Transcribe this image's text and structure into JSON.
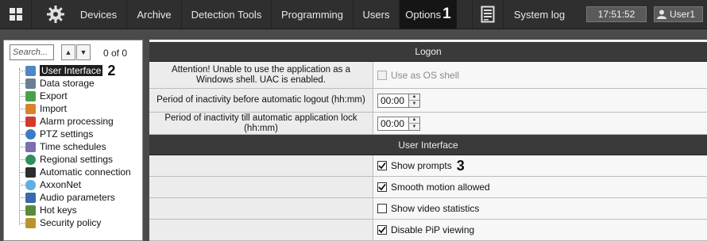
{
  "topbar": {
    "tabs": [
      "Devices",
      "Archive",
      "Detection Tools",
      "Programming",
      "Users",
      "Options"
    ],
    "active_tab": "Options",
    "active_marker": "1",
    "system_log_label": "System log",
    "clock": "17:51:52",
    "user_label": "User1"
  },
  "sidebar": {
    "search_placeholder": "Search...",
    "count": "0 of 0",
    "selected_marker": "2",
    "items": [
      {
        "label": "User Interface",
        "icon": "monitor-icon"
      },
      {
        "label": "Data storage",
        "icon": "storage-icon"
      },
      {
        "label": "Export",
        "icon": "export-icon"
      },
      {
        "label": "Import",
        "icon": "import-icon"
      },
      {
        "label": "Alarm processing",
        "icon": "alarm-icon"
      },
      {
        "label": "PTZ settings",
        "icon": "ptz-icon"
      },
      {
        "label": "Time schedules",
        "icon": "schedule-icon"
      },
      {
        "label": "Regional settings",
        "icon": "globe-icon"
      },
      {
        "label": "Automatic connection",
        "icon": "connection-icon"
      },
      {
        "label": "AxxonNet",
        "icon": "cloud-icon"
      },
      {
        "label": "Audio parameters",
        "icon": "audio-icon"
      },
      {
        "label": "Hot keys",
        "icon": "hotkeys-icon"
      },
      {
        "label": "Security policy",
        "icon": "security-icon"
      }
    ]
  },
  "logon": {
    "title": "Logon",
    "rows": [
      {
        "label": "Attention! Unable to use the application as a Windows shell. UAC is enabled.",
        "control": "Use as OS shell"
      },
      {
        "label": "Period of inactivity before automatic logout (hh:mm)",
        "value": "00:00"
      },
      {
        "label": "Period of inactivity till automatic application lock (hh:mm)",
        "value": "00:00"
      }
    ]
  },
  "ui": {
    "title": "User Interface",
    "marker": "3",
    "options": [
      {
        "label": "Show prompts",
        "checked": true
      },
      {
        "label": "Smooth motion allowed",
        "checked": true
      },
      {
        "label": "Show video statistics",
        "checked": false
      },
      {
        "label": "Disable PiP viewing",
        "checked": true
      }
    ]
  },
  "colors": {
    "topbar": "#2f2f2f",
    "active_tab": "#151515",
    "section_header": "#3a3a3a",
    "selection": "#1f1f1f"
  }
}
